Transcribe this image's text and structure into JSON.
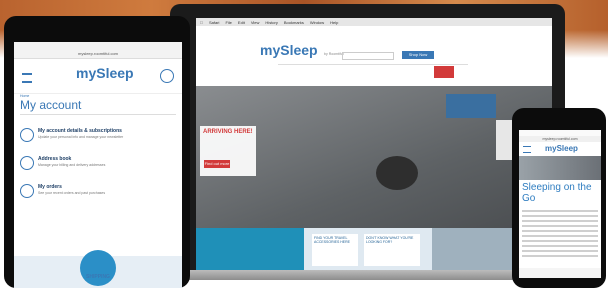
{
  "brand": {
    "name": "mySleep",
    "by": "by Roomtiful",
    "accent": "#3a78b5",
    "red": "#d23a3a"
  },
  "laptop": {
    "menu_items": [
      "Safari",
      "File",
      "Edit",
      "View",
      "History",
      "Bookmarks",
      "Window",
      "Help"
    ],
    "hero_promo": {
      "headline": "ARRIVING HERE!",
      "button": "Find out more"
    },
    "cta_button": "Shop Now",
    "footer_tiles": [
      "FIND YOUR TRAVEL ACCESSORIES HERE",
      "DON'T KNOW WHAT YOU'RE LOOKING FOR?"
    ]
  },
  "tablet": {
    "url": "mysleep.roomtiful.com",
    "page_title": "My account",
    "breadcrumb": "Home",
    "items": [
      {
        "title": "My account details & subscriptions",
        "subtitle": "Update your personal info and manage your newsletter"
      },
      {
        "title": "Address book",
        "subtitle": "Manage your billing and delivery addresses"
      },
      {
        "title": "My orders",
        "subtitle": "See your recent orders and past purchases"
      }
    ],
    "bottom_label": "SHIPPING"
  },
  "phone": {
    "url": "mysleep.roomtiful.com",
    "headline": "Sleeping on the Go"
  }
}
